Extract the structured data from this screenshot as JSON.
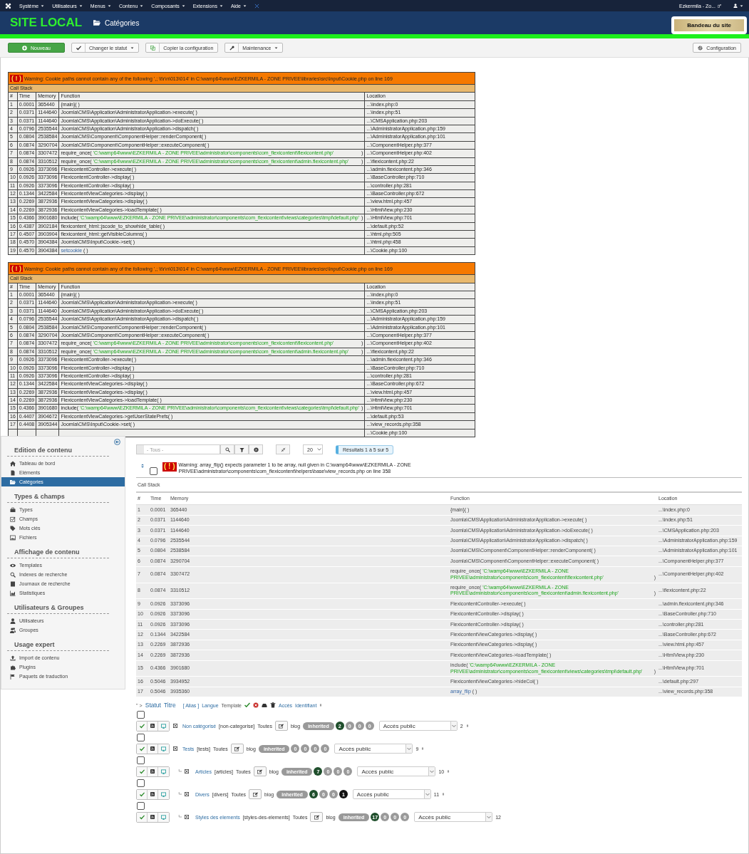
{
  "top_menu": {
    "items": [
      {
        "label": "Système"
      },
      {
        "label": "Utilisateurs"
      },
      {
        "label": "Menus"
      },
      {
        "label": "Contenu"
      },
      {
        "label": "Composants"
      },
      {
        "label": "Extensions"
      },
      {
        "label": "Aide"
      }
    ],
    "site_link": "Ezkermila - Zo..."
  },
  "header": {
    "site_title": "SITE LOCAL",
    "page_title": "Catégories",
    "banner_button": "Bandeau du site"
  },
  "toolbar": {
    "buttons": [
      {
        "label": "Nouveau",
        "kind": "primary"
      },
      {
        "label": "Changer le statut",
        "kind": "dropdown"
      },
      {
        "label": "Copier la configuration",
        "kind": "plain"
      },
      {
        "label": "Maintenance",
        "kind": "dropdown"
      }
    ],
    "options_button": "Configuration"
  },
  "errors": [
    {
      "badge": "( ! )",
      "warning": "Warning: Cookie paths cannot contain any of the following ',; \\t\\r\\n\\013\\014' in C:\\wamp64\\www\\EZKERMILA - ZONE PRIVEE\\libraries\\src\\Input\\Cookie.php on line 169",
      "call_stack": "Call Stack",
      "columns": [
        "#",
        "Time",
        "Memory",
        "Function",
        "Location"
      ],
      "rows": [
        {
          "n": "1",
          "time": "0.0001",
          "memory": "365440",
          "kind": "plain",
          "function": "{main}( )",
          "location": "...\\index.php:0"
        },
        {
          "n": "2",
          "time": "0.0371",
          "memory": "1144640",
          "kind": "plain",
          "function": "Joomla\\CMS\\Application\\AdministratorApplication->execute( )",
          "location": "...\\index.php:51"
        },
        {
          "n": "3",
          "time": "0.0371",
          "memory": "1144640",
          "kind": "plain",
          "function": "Joomla\\CMS\\Application\\AdministratorApplication->doExecute( )",
          "location": "...\\CMSApplication.php:203"
        },
        {
          "n": "4",
          "time": "0.0796",
          "memory": "2535544",
          "kind": "plain",
          "function": "Joomla\\CMS\\Application\\AdministratorApplication->dispatch( )",
          "location": "...\\AdministratorApplication.php:159"
        },
        {
          "n": "5",
          "time": "0.0804",
          "memory": "2538584",
          "kind": "plain",
          "function": "Joomla\\CMS\\Component\\ComponentHelper::renderComponent( )",
          "location": "...\\AdministratorApplication.php:101"
        },
        {
          "n": "6",
          "time": "0.0874",
          "memory": "3290704",
          "kind": "plain",
          "function": "Joomla\\CMS\\Component\\ComponentHelper::executeComponent( )",
          "location": "...\\ComponentHelper.php:377"
        },
        {
          "n": "7",
          "time": "0.0874",
          "memory": "3307472",
          "kind": "path",
          "function": "require_once(",
          "path": "'C:\\wamp64\\www\\EZKERMILA - ZONE PRIVEE\\administrator\\components\\com_flexicontent\\flexicontent.php'",
          "close": ")",
          "location": "...\\ComponentHelper.php:402"
        },
        {
          "n": "8",
          "time": "0.0874",
          "memory": "3310512",
          "kind": "path",
          "function": "require_once(",
          "path": "'C:\\wamp64\\www\\EZKERMILA - ZONE PRIVEE\\administrator\\components\\com_flexicontent\\admin.flexicontent.php'",
          "close": ")",
          "location": "...\\flexicontent.php:22"
        },
        {
          "n": "9",
          "time": "0.0926",
          "memory": "3373096",
          "kind": "plain",
          "function": "FlexicontentController->execute( )",
          "location": "...\\admin.flexicontent.php:346"
        },
        {
          "n": "10",
          "time": "0.0926",
          "memory": "3373096",
          "kind": "plain",
          "function": "FlexicontentController->display( )",
          "location": "...\\BaseController.php:710"
        },
        {
          "n": "11",
          "time": "0.0926",
          "memory": "3373096",
          "kind": "plain",
          "function": "FlexicontentController->display( )",
          "location": "...\\controller.php:281"
        },
        {
          "n": "12",
          "time": "0.1344",
          "memory": "3422584",
          "kind": "plain",
          "function": "FlexicontentViewCategories->display( )",
          "location": "...\\BaseController.php:672"
        },
        {
          "n": "13",
          "time": "0.2269",
          "memory": "3872936",
          "kind": "plain",
          "function": "FlexicontentViewCategories->display( )",
          "location": "...\\view.html.php:457"
        },
        {
          "n": "14",
          "time": "0.2269",
          "memory": "3872936",
          "kind": "plain",
          "function": "FlexicontentViewCategories->loadTemplate( )",
          "location": "...\\HtmlView.php:230"
        },
        {
          "n": "15",
          "time": "0.4366",
          "memory": "3901680",
          "kind": "path",
          "function": "include(",
          "path": "'C:\\wamp64\\www\\EZKERMILA - ZONE PRIVEE\\administrator\\components\\com_flexicontent\\views\\categories\\tmpl\\default.php'",
          "close": ")",
          "location": "...\\HtmlView.php:701"
        },
        {
          "n": "16",
          "time": "0.4387",
          "memory": "3902184",
          "kind": "plain",
          "function": "flexicontent_html::jscode_to_showhide_table( )",
          "location": "...\\default.php:52"
        },
        {
          "n": "17",
          "time": "0.4507",
          "memory": "3903904",
          "kind": "plain",
          "function": "flexicontent_html::getVisibleColumns( )",
          "location": "...\\html.php:505"
        },
        {
          "n": "18",
          "time": "0.4570",
          "memory": "3904384",
          "kind": "plain",
          "function": "Joomla\\CMS\\Input\\Cookie->set( )",
          "location": "...\\html.php:458"
        },
        {
          "n": "19",
          "time": "0.4570",
          "memory": "3904384",
          "kind": "link",
          "function": "setcookie",
          "args": "( )",
          "location": "...\\Cookie.php:100"
        }
      ]
    },
    {
      "badge": "( ! )",
      "warning": "Warning: Cookie paths cannot contain any of the following ',; \\t\\r\\n\\013\\014' in C:\\wamp64\\www\\EZKERMILA - ZONE PRIVEE\\libraries\\src\\Input\\Cookie.php on line 169",
      "call_stack": "Call Stack",
      "columns": [
        "#",
        "Time",
        "Memory",
        "Function",
        "Location"
      ],
      "rows": [
        {
          "n": "1",
          "time": "0.0001",
          "memory": "365440",
          "kind": "plain",
          "function": "{main}( )",
          "location": "...\\index.php:0"
        },
        {
          "n": "2",
          "time": "0.0371",
          "memory": "1144640",
          "kind": "plain",
          "function": "Joomla\\CMS\\Application\\AdministratorApplication->execute( )",
          "location": "...\\index.php:51"
        },
        {
          "n": "3",
          "time": "0.0371",
          "memory": "1144640",
          "kind": "plain",
          "function": "Joomla\\CMS\\Application\\AdministratorApplication->doExecute( )",
          "location": "...\\CMSApplication.php:203"
        },
        {
          "n": "4",
          "time": "0.0796",
          "memory": "2535544",
          "kind": "plain",
          "function": "Joomla\\CMS\\Application\\AdministratorApplication->dispatch( )",
          "location": "...\\AdministratorApplication.php:159"
        },
        {
          "n": "5",
          "time": "0.0804",
          "memory": "2538584",
          "kind": "plain",
          "function": "Joomla\\CMS\\Component\\ComponentHelper::renderComponent( )",
          "location": "...\\AdministratorApplication.php:101"
        },
        {
          "n": "6",
          "time": "0.0874",
          "memory": "3290704",
          "kind": "plain",
          "function": "Joomla\\CMS\\Component\\ComponentHelper::executeComponent( )",
          "location": "...\\ComponentHelper.php:377"
        },
        {
          "n": "7",
          "time": "0.0874",
          "memory": "3307472",
          "kind": "path",
          "function": "require_once(",
          "path": "'C:\\wamp64\\www\\EZKERMILA - ZONE PRIVEE\\administrator\\components\\com_flexicontent\\flexicontent.php'",
          "close": ")",
          "location": "...\\ComponentHelper.php:402"
        },
        {
          "n": "8",
          "time": "0.0874",
          "memory": "3310512",
          "kind": "path",
          "function": "require_once(",
          "path": "'C:\\wamp64\\www\\EZKERMILA - ZONE PRIVEE\\administrator\\components\\com_flexicontent\\admin.flexicontent.php'",
          "close": ")",
          "location": "...\\flexicontent.php:22"
        },
        {
          "n": "9",
          "time": "0.0926",
          "memory": "3373096",
          "kind": "plain",
          "function": "FlexicontentController->execute( )",
          "location": "...\\admin.flexicontent.php:346"
        },
        {
          "n": "10",
          "time": "0.0926",
          "memory": "3373096",
          "kind": "plain",
          "function": "FlexicontentController->display( )",
          "location": "...\\BaseController.php:710"
        },
        {
          "n": "11",
          "time": "0.0926",
          "memory": "3373096",
          "kind": "plain",
          "function": "FlexicontentController->display( )",
          "location": "...\\controller.php:281"
        },
        {
          "n": "12",
          "time": "0.1344",
          "memory": "3422584",
          "kind": "plain",
          "function": "FlexicontentViewCategories->display( )",
          "location": "...\\BaseController.php:672"
        },
        {
          "n": "13",
          "time": "0.2269",
          "memory": "3872936",
          "kind": "plain",
          "function": "FlexicontentViewCategories->display( )",
          "location": "...\\view.html.php:457"
        },
        {
          "n": "14",
          "time": "0.2269",
          "memory": "3872936",
          "kind": "plain",
          "function": "FlexicontentViewCategories->loadTemplate( )",
          "location": "...\\HtmlView.php:230"
        },
        {
          "n": "15",
          "time": "0.4366",
          "memory": "3901680",
          "kind": "path",
          "function": "include(",
          "path": "'C:\\wamp64\\www\\EZKERMILA - ZONE PRIVEE\\administrator\\components\\com_flexicontent\\views\\categories\\tmpl\\default.php'",
          "close": ")",
          "location": "...\\HtmlView.php:701"
        },
        {
          "n": "16",
          "time": "0.4407",
          "memory": "3904672",
          "kind": "plain",
          "function": "FlexicontentViewCategories->getUserStatePrefs( )",
          "location": "...\\default.php:53"
        },
        {
          "n": "17",
          "time": "0.4408",
          "memory": "3905344",
          "kind": "plain",
          "function": "Joomla\\CMS\\Input\\Cookie->set( )",
          "location": "...\\view_records.php:358"
        },
        {
          "kind": "hidden",
          "location": "...\\Cookie.php:100"
        }
      ]
    }
  ],
  "sidebar": {
    "sections": [
      {
        "title": "Edition de contenu",
        "items": [
          {
            "label": "Tableau de bord",
            "selected": false
          },
          {
            "label": "Eléments",
            "selected": false
          },
          {
            "label": "Catégories",
            "selected": true
          }
        ]
      },
      {
        "title": "Types & champs",
        "items": [
          {
            "label": "Types",
            "selected": false
          },
          {
            "label": "Champs",
            "selected": false
          },
          {
            "label": "Mots clés",
            "selected": false
          },
          {
            "label": "Fichiers",
            "selected": false
          }
        ]
      },
      {
        "title": "Affichage de contenu",
        "items": [
          {
            "label": "Templates",
            "selected": false
          },
          {
            "label": "Indexes de recherche",
            "selected": false
          },
          {
            "label": "Journaux de recherche",
            "selected": false
          },
          {
            "label": "Statistiques",
            "selected": false
          }
        ]
      },
      {
        "title": "Utilisateurs & Groupes",
        "items": [
          {
            "label": "Utilisateurs",
            "selected": false
          },
          {
            "label": "Groupes",
            "selected": false
          }
        ]
      },
      {
        "title": "Usage expert",
        "items": [
          {
            "label": "Import de contenu",
            "selected": false
          },
          {
            "label": "Plugins",
            "selected": false
          },
          {
            "label": "Paquets de traduction",
            "selected": false
          }
        ]
      }
    ]
  },
  "filters": {
    "placeholder": "- Tous -",
    "limit": "20",
    "results": "Résultats 1 à 5 sur 5"
  },
  "list_error": {
    "badge": "( ! )",
    "warning": "Warning: array_flip() expects parameter 1 to be array, null given in C:\\wamp64\\www\\EZKERMILA - ZONE PRIVEE\\administrator\\components\\com_flexicontent\\helpers\\base\\view_records.php on line 358",
    "checked": false,
    "call_stack": "Call Stack",
    "columns": [
      "#",
      "Time",
      "Memory",
      "Function",
      "Location"
    ],
    "rows": [
      {
        "n": "1",
        "time": "0.0001",
        "memory": "365440",
        "kind": "plain",
        "function": "{main}( )",
        "location": "...\\index.php:0"
      },
      {
        "n": "2",
        "time": "0.0371",
        "memory": "1144640",
        "kind": "plain",
        "function": "Joomla\\CMS\\Application\\AdministratorApplication->execute( )",
        "location": "...\\index.php:51"
      },
      {
        "n": "3",
        "time": "0.0371",
        "memory": "1144640",
        "kind": "plain",
        "function": "Joomla\\CMS\\Application\\AdministratorApplication->doExecute( )",
        "location": "...\\CMSApplication.php:203"
      },
      {
        "n": "4",
        "time": "0.0796",
        "memory": "2535544",
        "kind": "plain",
        "function": "Joomla\\CMS\\Application\\AdministratorApplication->dispatch( )",
        "location": "...\\AdministratorApplication.php:159"
      },
      {
        "n": "5",
        "time": "0.0804",
        "memory": "2538584",
        "kind": "plain",
        "function": "Joomla\\CMS\\Component\\ComponentHelper::renderComponent( )",
        "location": "...\\AdministratorApplication.php:101"
      },
      {
        "n": "6",
        "time": "0.0874",
        "memory": "3290704",
        "kind": "plain",
        "function": "Joomla\\CMS\\Component\\ComponentHelper::executeComponent( )",
        "location": "...\\ComponentHelper.php:377"
      },
      {
        "n": "7",
        "time": "0.0874",
        "memory": "3307472",
        "kind": "path",
        "function": "require_once(",
        "path": "'C:\\wamp64\\www\\EZKERMILA - ZONE PRIVEE\\administrator\\components\\com_flexicontent\\flexicontent.php'",
        "close": ")",
        "location": "...\\ComponentHelper.php:402"
      },
      {
        "n": "8",
        "time": "0.0874",
        "memory": "3310512",
        "kind": "path",
        "function": "require_once(",
        "path": "'C:\\wamp64\\www\\EZKERMILA - ZONE PRIVEE\\administrator\\components\\com_flexicontent\\admin.flexicontent.php'",
        "close": ")",
        "location": "...\\flexicontent.php:22"
      },
      {
        "n": "9",
        "time": "0.0926",
        "memory": "3373096",
        "kind": "plain",
        "function": "FlexicontentController->execute( )",
        "location": "...\\admin.flexicontent.php:346"
      },
      {
        "n": "10",
        "time": "0.0926",
        "memory": "3373096",
        "kind": "plain",
        "function": "FlexicontentController->display( )",
        "location": "...\\BaseController.php:710"
      },
      {
        "n": "11",
        "time": "0.0926",
        "memory": "3373096",
        "kind": "plain",
        "function": "FlexicontentController->display( )",
        "location": "...\\controller.php:281"
      },
      {
        "n": "12",
        "time": "0.1344",
        "memory": "3422584",
        "kind": "plain",
        "function": "FlexicontentViewCategories->display( )",
        "location": "...\\BaseController.php:672"
      },
      {
        "n": "13",
        "time": "0.2269",
        "memory": "3872936",
        "kind": "plain",
        "function": "FlexicontentViewCategories->display( )",
        "location": "...\\view.html.php:457"
      },
      {
        "n": "14",
        "time": "0.2269",
        "memory": "3872936",
        "kind": "plain",
        "function": "FlexicontentViewCategories->loadTemplate( )",
        "location": "...\\HtmlView.php:230"
      },
      {
        "n": "15",
        "time": "0.4366",
        "memory": "3901680",
        "kind": "path",
        "function": "include(",
        "path": "'C:\\wamp64\\www\\EZKERMILA - ZONE PRIVEE\\administrator\\components\\com_flexicontent\\views\\categories\\tmpl\\default.php'",
        "close": ")",
        "location": "...\\HtmlView.php:701"
      },
      {
        "n": "16",
        "time": "0.5046",
        "memory": "3934952",
        "kind": "plain",
        "function": "FlexicontentViewCategories->hideCol( )",
        "location": "...\\default.php:297"
      },
      {
        "n": "17",
        "time": "0.5046",
        "memory": "3935360",
        "kind": "link",
        "function": "array_flip",
        "args": "( )",
        "location": "...\\view_records.php:358"
      }
    ]
  },
  "list_header": {
    "prefix": "'' >",
    "sort_links": [
      "Statut",
      "Titre"
    ],
    "alias": "[ Alias ]",
    "language": "Langue",
    "template": "Template",
    "access": "Accès",
    "id": "Identifiant"
  },
  "categories": [
    {
      "title": "Non catégorisé",
      "alias": "[non-categorise]",
      "language": "Toutes",
      "template": "blog",
      "inheritance": "inherited",
      "counts": [
        {
          "value": "2",
          "color": "#1f4f2c"
        },
        {
          "value": "0",
          "color": "#9a9a9a"
        },
        {
          "value": "0",
          "color": "#9a9a9a"
        },
        {
          "value": "0",
          "color": "#9a9a9a"
        }
      ],
      "access": "Accès public",
      "id": "2",
      "sortable": true,
      "checked": false
    },
    {
      "title": "Tests",
      "alias": "[tests]",
      "language": "Toutes",
      "template": "blog",
      "inheritance": "inherited",
      "counts": [
        {
          "value": "0",
          "color": "#9a9a9a"
        },
        {
          "value": "0",
          "color": "#9a9a9a"
        },
        {
          "value": "0",
          "color": "#9a9a9a"
        },
        {
          "value": "0",
          "color": "#9a9a9a"
        }
      ],
      "access": "Accès public",
      "id": "9",
      "sortable": true,
      "checked": false,
      "children": [
        {
          "title": "Articles",
          "alias": "[articles]",
          "language": "Toutes",
          "template": "blog",
          "inheritance": "inherited",
          "counts": [
            {
              "value": "7",
              "color": "#1f4f2c"
            },
            {
              "value": "0",
              "color": "#9a9a9a"
            },
            {
              "value": "0",
              "color": "#9a9a9a"
            },
            {
              "value": "0",
              "color": "#9a9a9a"
            }
          ],
          "access": "Accès public",
          "id": "10",
          "sortable": true,
          "checked": false
        },
        {
          "title": "Divers",
          "alias": "[divers]",
          "language": "Toutes",
          "template": "blog",
          "inheritance": "inherited",
          "counts": [
            {
              "value": "6",
              "color": "#1f4f2c"
            },
            {
              "value": "0",
              "color": "#9a9a9a"
            },
            {
              "value": "0",
              "color": "#9a9a9a"
            },
            {
              "value": "1",
              "color": "#111111"
            }
          ],
          "access": "Accès public",
          "id": "11",
          "sortable": true,
          "checked": false
        },
        {
          "title": "Styles des elements",
          "alias": "[styles-des-elements]",
          "language": "Toutes",
          "template": "blog",
          "inheritance": "inherited",
          "counts": [
            {
              "value": "17",
              "color": "#1f4f2c"
            },
            {
              "value": "0",
              "color": "#9a9a9a"
            },
            {
              "value": "0",
              "color": "#9a9a9a"
            },
            {
              "value": "0",
              "color": "#9a9a9a"
            }
          ],
          "access": "Accès public",
          "id": "12",
          "sortable": false,
          "checked": false
        }
      ]
    }
  ]
}
